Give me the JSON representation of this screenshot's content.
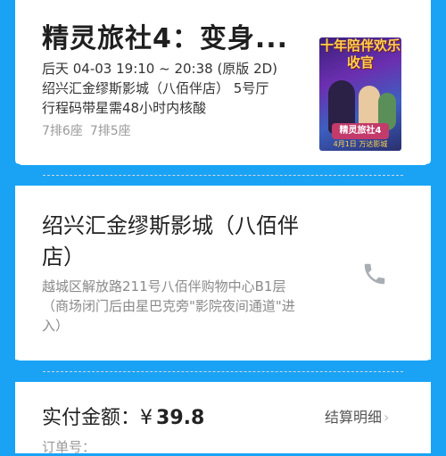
{
  "ticket": {
    "movie_title": "精灵旅社4：变身...",
    "show_time": "后天 04-03 19:10 ~ 20:38 (原版 2D)",
    "cinema_hall": "绍兴汇金缪斯影城（八佰伴店） 5号厅",
    "note": "行程码带星需48小时内核酸",
    "seats": [
      "7排6座",
      "7排5座"
    ]
  },
  "poster": {
    "top_text": "十年陪伴欢乐收官",
    "logo_text": "精灵旅社4",
    "bottom_text": "4月1日 万达影城"
  },
  "cinema": {
    "name": "绍兴汇金缪斯影城（八佰伴店）",
    "address": "越城区解放路211号八佰伴购物中心B1层（商场闭门后由星巴克旁\"影院夜间通道\"进入）",
    "phone_icon": "phone-icon"
  },
  "payment": {
    "label": "实付金额：",
    "currency": "¥",
    "amount": "39.8",
    "detail_label": "结算明细",
    "order_label": "订单号："
  },
  "colors": {
    "background": "#1aa3f5",
    "card": "#ffffff"
  }
}
